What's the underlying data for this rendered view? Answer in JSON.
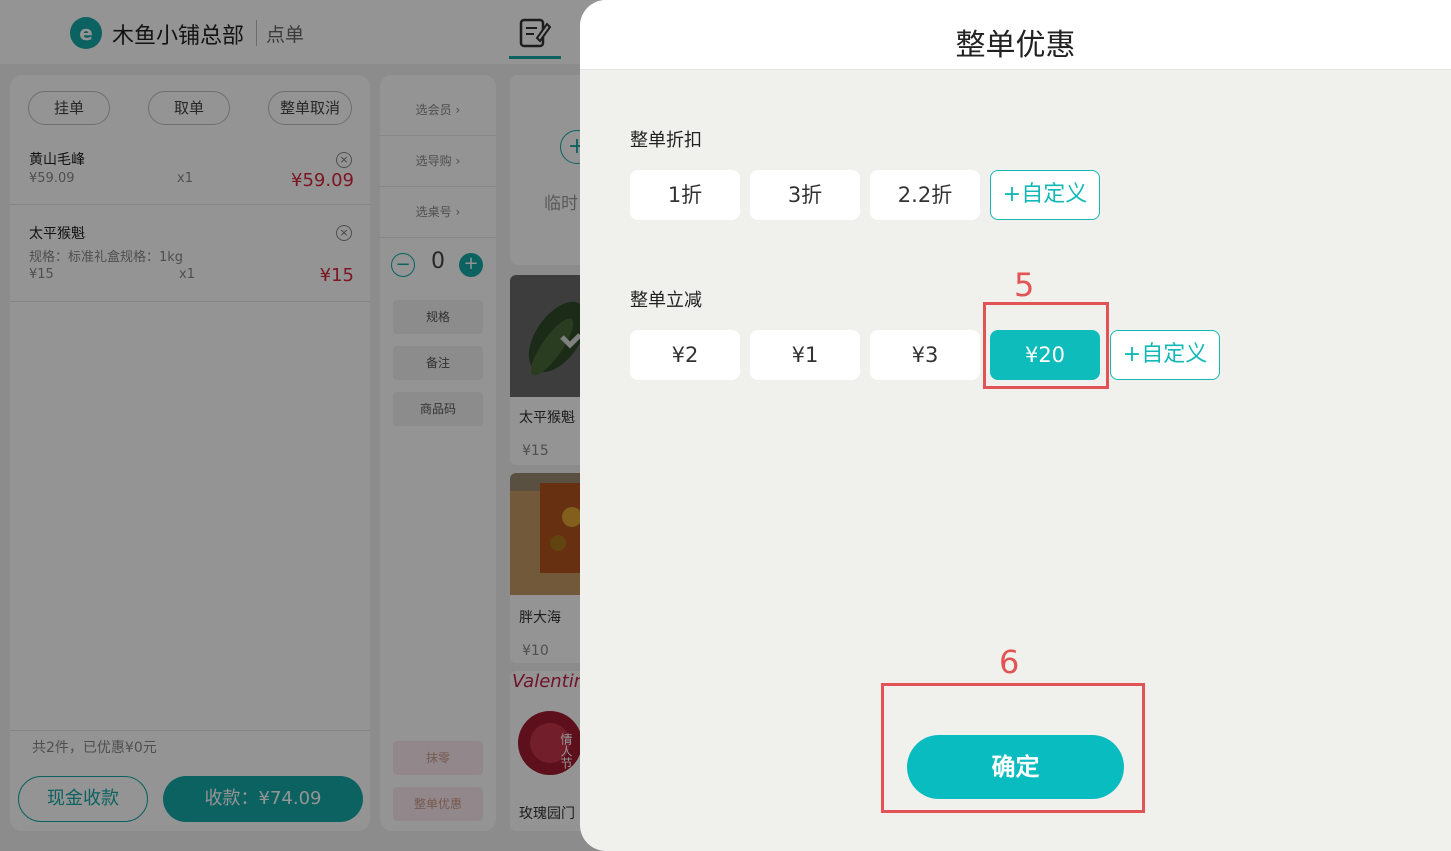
{
  "header": {
    "store_name": "木鱼小铺总部",
    "mode_label": "点单",
    "logo_letter": "e"
  },
  "order_actions": [
    "挂单",
    "取单",
    "整单取消"
  ],
  "order_items": [
    {
      "name": "黄山毛峰",
      "spec": "",
      "unit_price": "¥59.09",
      "qty": "x1",
      "total": "¥59.09"
    },
    {
      "name": "太平猴魁",
      "spec": "规格：标准礼盒规格：1kg",
      "unit_price": "¥15",
      "qty": "x1",
      "total": "¥15"
    }
  ],
  "summary": "共2件，已优惠¥0元",
  "cash_button": "现金收款",
  "pay_button": "收款：¥74.09",
  "mid_panel": {
    "links": [
      "选会员",
      "选导购",
      "选桌号"
    ],
    "stepper_value": "0",
    "buttons": [
      "规格",
      "备注",
      "商品码"
    ],
    "bottom_buttons": [
      "抹零",
      "整单优惠"
    ]
  },
  "product_panel": {
    "temp_label": "临时",
    "products": [
      {
        "name": "太平猴魁",
        "price": "¥15"
      },
      {
        "name": "胖大海",
        "price": "¥10"
      },
      {
        "name": "玫瑰园门",
        "price": ""
      }
    ],
    "valentine_text": "Valentin",
    "badge_text": "情人节"
  },
  "modal": {
    "title": "整单优惠",
    "discount_section": {
      "label": "整单折扣",
      "options": [
        "1折",
        "3折",
        "2.2折"
      ],
      "custom_label": "+自定义"
    },
    "reduction_section": {
      "label": "整单立减",
      "options": [
        "¥2",
        "¥1",
        "¥3",
        "¥20"
      ],
      "selected": "¥20",
      "custom_label": "+自定义"
    },
    "confirm_label": "确定"
  },
  "annotations": [
    "5",
    "6"
  ],
  "colors": {
    "accent": "#0fbcbc",
    "price_red": "#d7263d",
    "annotation_red": "#e25355"
  }
}
